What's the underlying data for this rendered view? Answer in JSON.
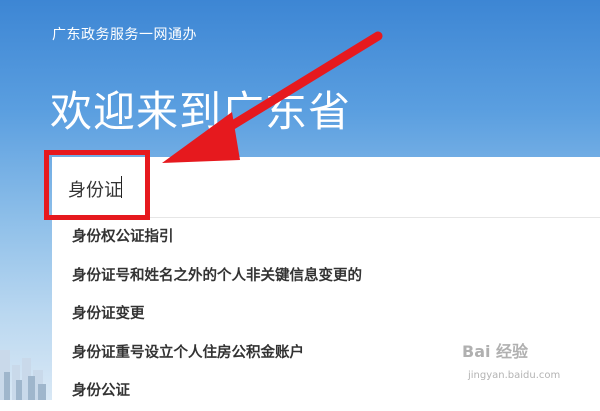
{
  "header": {
    "site_name": "广东政务服务一网通办",
    "welcome": "欢迎来到广东省"
  },
  "search": {
    "value": "身份证"
  },
  "suggestions": [
    "身份权公证指引",
    "身份证号和姓名之外的个人非关键信息变更的",
    "身份证变更",
    "身份证重号设立个人住房公积金账户",
    "身份公证"
  ],
  "watermark": {
    "brand": "Bai 经验",
    "url": "jingyan.baidu.com"
  },
  "colors": {
    "annotation_red": "#e6191e",
    "hero_blue": "#3d86d4"
  }
}
